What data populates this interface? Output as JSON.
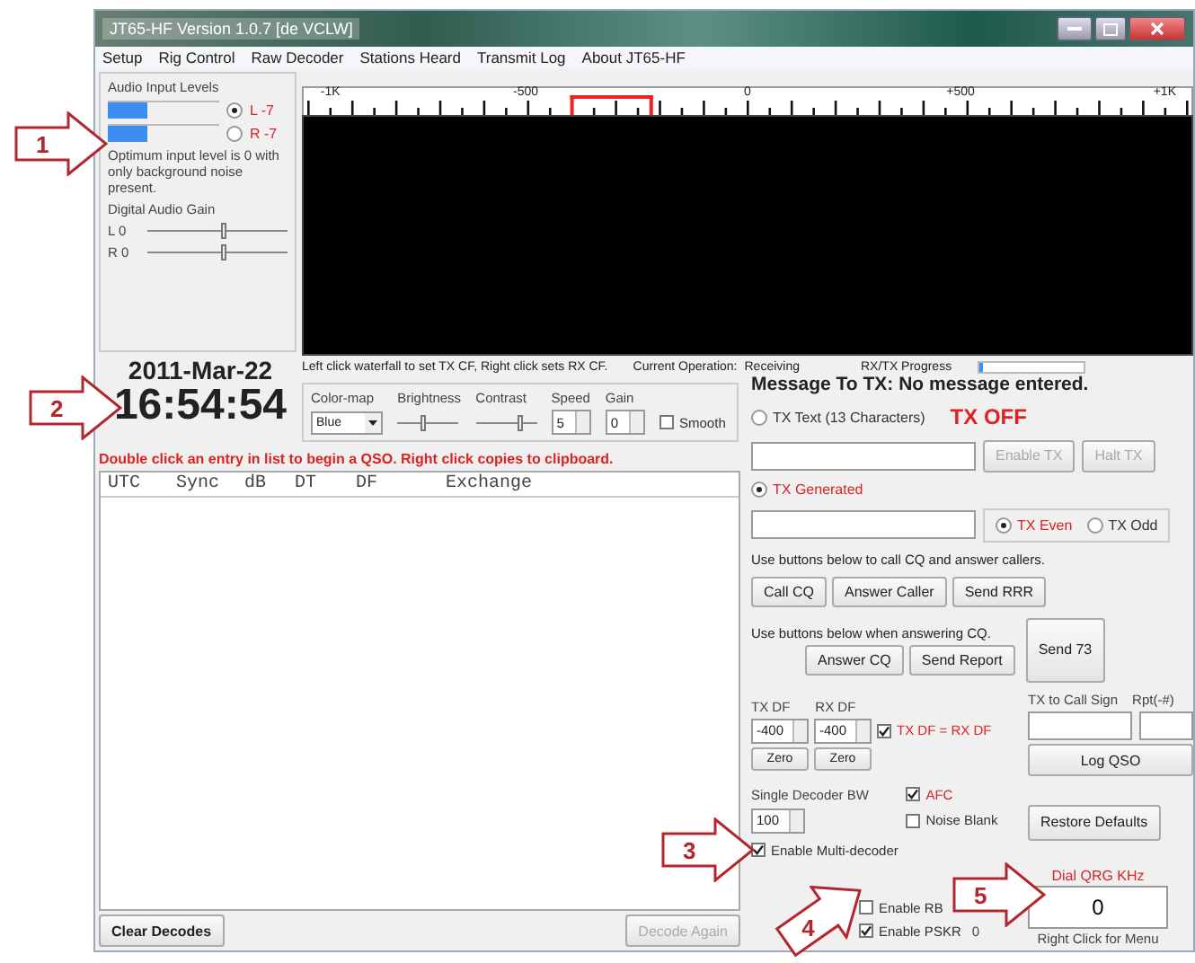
{
  "window": {
    "title": "JT65-HF Version 1.0.7  [de VCLW]"
  },
  "menu": [
    "Setup",
    "Rig Control",
    "Raw Decoder",
    "Stations Heard",
    "Transmit Log",
    "About JT65-HF"
  ],
  "audio": {
    "title": "Audio Input Levels",
    "channels": [
      {
        "label": "L -7",
        "level": 0.35,
        "selected": true
      },
      {
        "label": "R -7",
        "level": 0.35,
        "selected": false
      }
    ],
    "note": "Optimum input level is 0 with only background noise present.",
    "gain_title": "Digital Audio Gain",
    "gains": [
      {
        "label": "L 0",
        "level": 0.55
      },
      {
        "label": "R 0",
        "level": 0.55
      }
    ]
  },
  "clock": {
    "date": "2011-Mar-22",
    "time": "16:54:54"
  },
  "waterfall": {
    "ticks": [
      "-1K",
      "-500",
      "0",
      "+500",
      "+1K"
    ]
  },
  "info": {
    "hint": "Left click waterfall to set TX CF, Right click sets RX CF.",
    "operation_label": "Current Operation:",
    "operation": "Receiving",
    "progress_label": "RX/TX Progress",
    "progress": {
      "level": 0.04
    }
  },
  "controls": {
    "colormap_label": "Color-map",
    "colormap": "Blue",
    "brightness_label": "Brightness",
    "brightness": {
      "level": 0.45
    },
    "contrast_label": "Contrast",
    "contrast": {
      "level": 0.75
    },
    "speed_label": "Speed",
    "speed": "5",
    "gain_label": "Gain",
    "gain": "0",
    "smooth": {
      "label": "Smooth",
      "checked": false
    }
  },
  "decodes": {
    "hint": "Double click an entry in list to begin a QSO.  Right click copies to clipboard.",
    "columns": [
      "UTC",
      "Sync",
      "dB",
      "DT",
      "DF",
      "Exchange"
    ],
    "buttons": [
      {
        "label": "Clear Decodes",
        "disabled": false
      },
      {
        "label": "Decode Again",
        "disabled": true
      }
    ]
  },
  "tx": {
    "title": "Message To TX:  No message entered.",
    "text_mode": {
      "label": "TX Text (13 Characters)",
      "selected": false
    },
    "status": "TX OFF",
    "enable_button": {
      "label": "Enable TX",
      "disabled": true
    },
    "halt_button": {
      "label": "Halt TX",
      "disabled": true
    },
    "generated_mode": {
      "label": "TX Generated",
      "selected": true
    },
    "periods": [
      {
        "label": "TX Even",
        "selected": true
      },
      {
        "label": "TX Odd",
        "selected": false
      }
    ],
    "cq_hint": "Use buttons below to call CQ and answer callers.",
    "cq_buttons": [
      "Call CQ",
      "Answer Caller",
      "Send RRR"
    ],
    "answer_hint": "Use buttons below when answering CQ.",
    "send73": "Send 73",
    "answer_buttons": [
      "Answer CQ",
      "Send Report"
    ],
    "txdf_label": "TX DF",
    "txdf": "-400",
    "rxdf_label": "RX DF",
    "rxdf": "-400",
    "lock": {
      "label": "TX DF = RX DF",
      "checked": true
    },
    "call_label": "TX to Call Sign",
    "report_label": "Rpt(-#)",
    "zero_buttons": [
      "Zero",
      "Zero"
    ],
    "log_button": "Log QSO",
    "bw_label": "Single Decoder BW",
    "bw": "100",
    "afc": {
      "label": "AFC",
      "checked": true
    },
    "noise": {
      "label": "Noise Blank",
      "checked": false
    },
    "restore_button": "Restore Defaults",
    "multi": {
      "label": "Enable Multi-decoder",
      "checked": true
    },
    "dial_label": "Dial QRG KHz",
    "dial": "0",
    "rb": {
      "label": "Enable RB",
      "checked": false
    },
    "pskr": {
      "label": "Enable PSKR",
      "checked": true
    },
    "pskr_count": "0",
    "menu_hint": "Right Click for Menu"
  },
  "callouts": [
    "1",
    "2",
    "3",
    "4",
    "5"
  ]
}
